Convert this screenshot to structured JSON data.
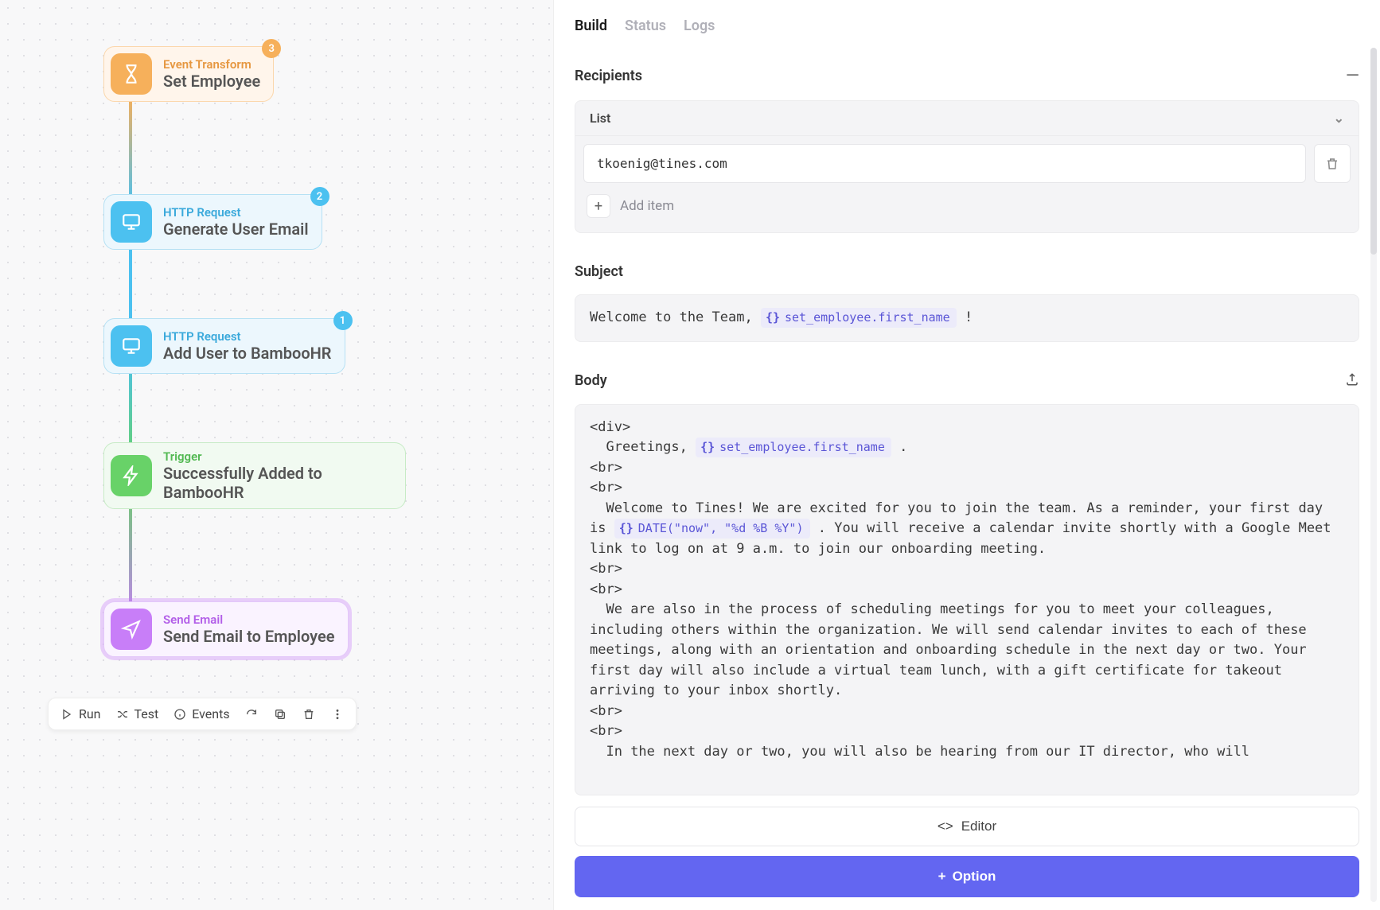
{
  "canvas": {
    "nodes": [
      {
        "type": "Event Transform",
        "title": "Set Employee",
        "badge": "3"
      },
      {
        "type": "HTTP Request",
        "title": "Generate User Email",
        "badge": "2"
      },
      {
        "type": "HTTP Request",
        "title": "Add User to BambooHR",
        "badge": "1"
      },
      {
        "type": "Trigger",
        "title": "Successfully Added to BambooHR",
        "badge": null
      },
      {
        "type": "Send Email",
        "title": "Send Email to Employee",
        "badge": null
      }
    ],
    "toolbar": {
      "run": "Run",
      "test": "Test",
      "events": "Events"
    }
  },
  "detail": {
    "tabs": [
      "Build",
      "Status",
      "Logs"
    ],
    "active_tab": "Build",
    "recipients": {
      "label": "Recipients",
      "list_label": "List",
      "items": [
        "tkoenig@tines.com"
      ],
      "add_item_placeholder": "Add item"
    },
    "subject": {
      "label": "Subject",
      "prefix": "Welcome to the Team, ",
      "pill": "set_employee.first_name",
      "suffix": " !"
    },
    "body": {
      "label": "Body",
      "pill1": "set_employee.first_name",
      "pill2": "DATE(\"now\", \"%d %B %Y\")",
      "seg_a": "<div>\n  Greetings, ",
      "seg_b": " .\n<br>\n<br>\n  Welcome to Tines! We are excited for you to join the team. As a reminder, your first day is ",
      "seg_c": " . You will receive a calendar invite shortly with a Google Meet link to log on at 9 a.m. to join our onboarding meeting.\n<br>\n<br>\n  We are also in the process of scheduling meetings for you to meet your colleagues, including others within the organization. We will send calendar invites to each of these meetings, along with an orientation and onboarding schedule in the next day or two. Your first day will also include a virtual team lunch, with a gift certificate for takeout arriving to your inbox shortly.\n<br>\n<br>\n  In the next day or two, you will also be hearing from our IT director, who will"
    },
    "editor_label": "Editor",
    "option_label": "Option"
  },
  "colors": {
    "orange": "#f6b05b",
    "blue": "#4cc1f0",
    "green": "#68d268",
    "purple": "#c87ef8",
    "accent": "#6366f1"
  }
}
